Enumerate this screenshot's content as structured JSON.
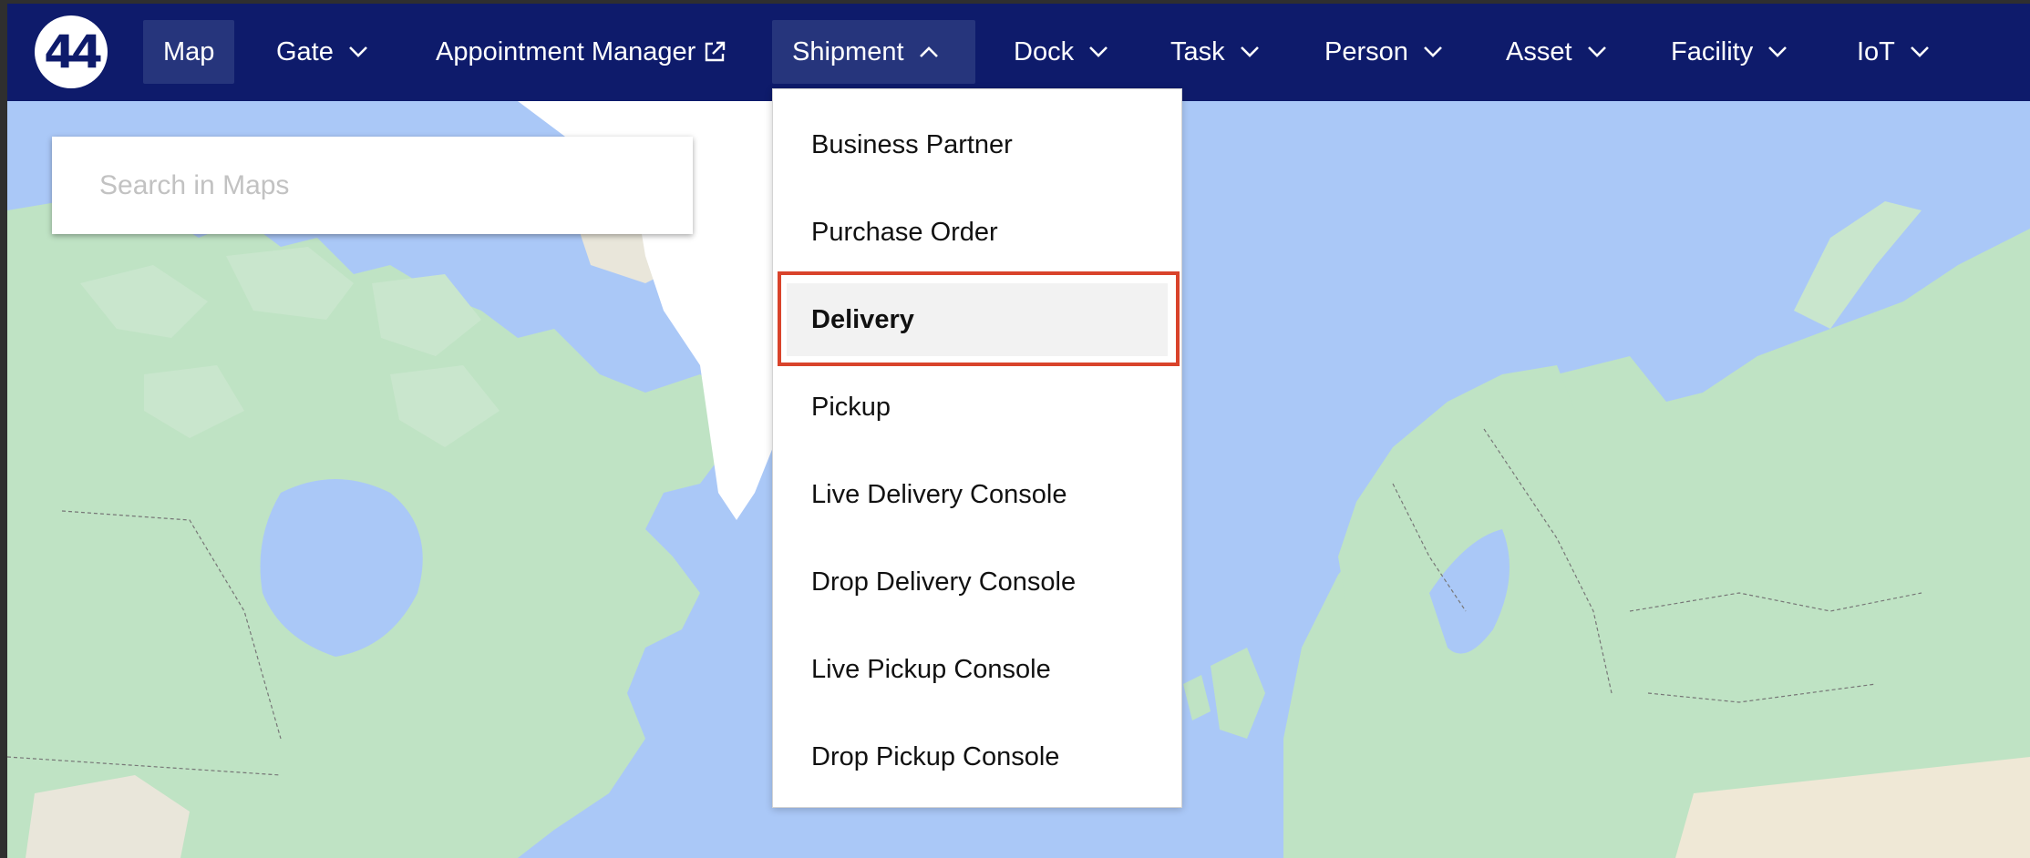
{
  "logo": {
    "text": "44"
  },
  "nav": {
    "map": "Map",
    "gate": "Gate",
    "appointment_manager": "Appointment Manager",
    "shipment": "Shipment",
    "dock": "Dock",
    "task": "Task",
    "person": "Person",
    "asset": "Asset",
    "facility": "Facility",
    "iot": "IoT"
  },
  "search": {
    "placeholder": "Search in Maps",
    "value": ""
  },
  "shipment_menu": {
    "items": [
      "Business Partner",
      "Purchase Order",
      "Delivery",
      "Pickup",
      "Live Delivery Console",
      "Drop Delivery Console",
      "Live Pickup Console",
      "Drop Pickup Console"
    ],
    "selected": "Delivery"
  },
  "colors": {
    "navbar": "#0e1b6b",
    "active_nav": "#26357c",
    "ocean": "#aac8f7",
    "land": "#bfe3c4",
    "highlight": "#d9432b"
  }
}
